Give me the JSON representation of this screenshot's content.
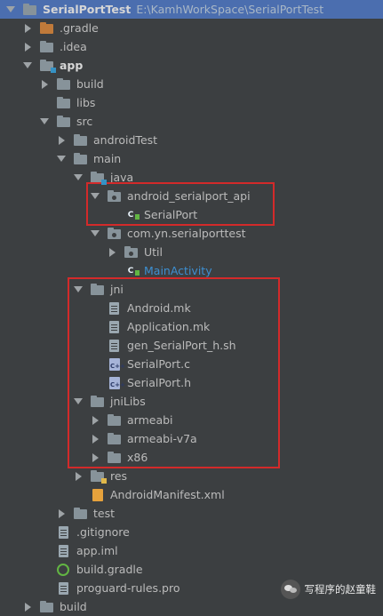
{
  "project": {
    "name": "SerialPortTest",
    "path": "E:\\KamhWorkSpace\\SerialPortTest"
  },
  "tree": [
    {
      "label": "SerialPortTest",
      "depth": 0,
      "arrow": "down",
      "icon": "folder",
      "bold": true,
      "selected": true,
      "path": "E:\\KamhWorkSpace\\SerialPortTest",
      "name": "project-root-folder"
    },
    {
      "label": ".gradle",
      "depth": 1,
      "arrow": "right",
      "icon": "folder-orange",
      "name": "gradle-folder"
    },
    {
      "label": ".idea",
      "depth": 1,
      "arrow": "right",
      "icon": "folder",
      "name": "idea-folder"
    },
    {
      "label": "app",
      "depth": 1,
      "arrow": "down",
      "icon": "folder-module",
      "bold": true,
      "name": "app-module-folder"
    },
    {
      "label": "build",
      "depth": 2,
      "arrow": "right",
      "icon": "folder",
      "name": "build-folder"
    },
    {
      "label": "libs",
      "depth": 2,
      "arrow": "none",
      "icon": "folder",
      "name": "libs-folder"
    },
    {
      "label": "src",
      "depth": 2,
      "arrow": "down",
      "icon": "folder",
      "name": "src-folder"
    },
    {
      "label": "androidTest",
      "depth": 3,
      "arrow": "right",
      "icon": "folder",
      "name": "androidtest-folder"
    },
    {
      "label": "main",
      "depth": 3,
      "arrow": "down",
      "icon": "folder",
      "name": "main-folder"
    },
    {
      "label": "java",
      "depth": 4,
      "arrow": "down",
      "icon": "folder-source",
      "name": "java-folder"
    },
    {
      "label": "android_serialport_api",
      "depth": 5,
      "arrow": "down",
      "icon": "package",
      "name": "package-android-serialport-api"
    },
    {
      "label": "SerialPort",
      "depth": 6,
      "arrow": "none",
      "icon": "class",
      "name": "serialport-class"
    },
    {
      "label": "com.yn.serialporttest",
      "depth": 5,
      "arrow": "down",
      "icon": "package",
      "name": "package-com-yn-serialporttest"
    },
    {
      "label": "Util",
      "depth": 6,
      "arrow": "right",
      "icon": "package",
      "name": "util-package"
    },
    {
      "label": "MainActivity",
      "depth": 6,
      "arrow": "none",
      "icon": "class",
      "blue": true,
      "name": "mainactivity-class"
    },
    {
      "label": "jni",
      "depth": 4,
      "arrow": "down",
      "icon": "folder",
      "name": "jni-folder"
    },
    {
      "label": "Android.mk",
      "depth": 5,
      "arrow": "none",
      "icon": "file",
      "name": "android-mk-file"
    },
    {
      "label": "Application.mk",
      "depth": 5,
      "arrow": "none",
      "icon": "file",
      "name": "application-mk-file"
    },
    {
      "label": "gen_SerialPort_h.sh",
      "depth": 5,
      "arrow": "none",
      "icon": "file",
      "name": "gen-serialport-sh-file"
    },
    {
      "label": "SerialPort.c",
      "depth": 5,
      "arrow": "none",
      "icon": "cfile",
      "name": "serialport-c-file"
    },
    {
      "label": "SerialPort.h",
      "depth": 5,
      "arrow": "none",
      "icon": "cfile",
      "name": "serialport-h-file"
    },
    {
      "label": "jniLibs",
      "depth": 4,
      "arrow": "down",
      "icon": "folder",
      "name": "jnilibs-folder"
    },
    {
      "label": "armeabi",
      "depth": 5,
      "arrow": "right",
      "icon": "folder",
      "name": "armeabi-folder"
    },
    {
      "label": "armeabi-v7a",
      "depth": 5,
      "arrow": "right",
      "icon": "folder",
      "name": "armeabi-v7a-folder"
    },
    {
      "label": "x86",
      "depth": 5,
      "arrow": "right",
      "icon": "folder",
      "name": "x86-folder"
    },
    {
      "label": "res",
      "depth": 4,
      "arrow": "right",
      "icon": "folder-res",
      "name": "res-folder"
    },
    {
      "label": "AndroidManifest.xml",
      "depth": 4,
      "arrow": "none",
      "icon": "xml",
      "name": "androidmanifest-file"
    },
    {
      "label": "test",
      "depth": 3,
      "arrow": "right",
      "icon": "folder",
      "name": "test-folder"
    },
    {
      "label": ".gitignore",
      "depth": 2,
      "arrow": "none",
      "icon": "file",
      "name": "gitignore-file"
    },
    {
      "label": "app.iml",
      "depth": 2,
      "arrow": "none",
      "icon": "file",
      "name": "app-iml-file"
    },
    {
      "label": "build.gradle",
      "depth": 2,
      "arrow": "none",
      "icon": "gradle",
      "name": "build-gradle-file"
    },
    {
      "label": "proguard-rules.pro",
      "depth": 2,
      "arrow": "none",
      "icon": "file",
      "name": "proguard-rules-file"
    },
    {
      "label": "build",
      "depth": 1,
      "arrow": "right",
      "icon": "folder",
      "name": "root-build-folder"
    }
  ],
  "watermark": {
    "text": "写程序的赵童鞋"
  },
  "colors": {
    "background": "#3c3f41",
    "selection": "#4b6eaf",
    "highlight_box": "#d32a2a",
    "modified_file": "#3d8fd1"
  },
  "icons": {
    "folder": "folder-icon",
    "class": "java-class-icon",
    "file": "text-file-icon",
    "cfile": "c-source-icon",
    "xml": "xml-file-icon",
    "gradle": "gradle-icon"
  }
}
